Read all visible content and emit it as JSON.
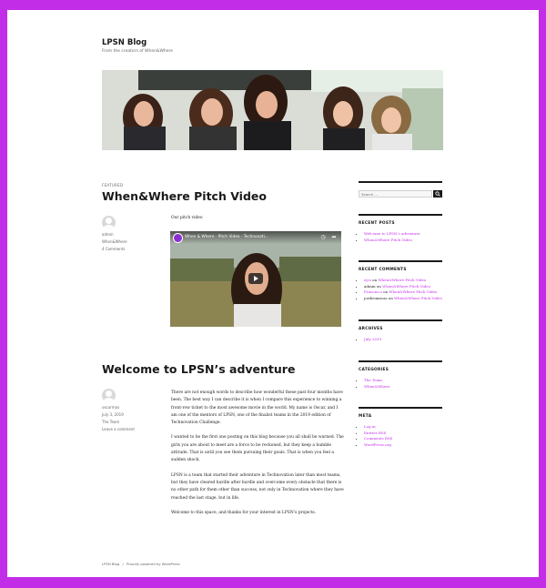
{
  "site": {
    "title": "LPSN Blog",
    "description": "From the creators of When&Where"
  },
  "posts": [
    {
      "label": "Featured",
      "title": "When&Where Pitch Video",
      "author": "admin",
      "category": "When&Where",
      "comments": "4 Comments",
      "intro": "Our pitch video",
      "video": {
        "title": "When & Where - Pitch Video - Technovati..."
      }
    },
    {
      "title": "Welcome to LPSN’s adventure",
      "author": "oscarmas",
      "date": "July 3, 2019",
      "category": "The Team",
      "comments": "Leave a comment",
      "paragraphs": [
        "There are not enough words to describe how wonderful these past four months have been. The best way I can describe it is when I compare this experience to winning a front-row ticket to the most awesome movie in the world. My name is Oscar, and I am one of the mentors of LPSN, one of the finalist teams in the 2019 edition of Technovation Challenge.",
        "I wanted to be the first one posting on this blog because you all shall be warned. The girls you are about to meet are a force to be reckoned, but they keep a humble attitude. That is until you see them pursuing their goals. That is when you feel a sudden shock.",
        "LPSN is a team that started their adventure in Technovation later than most teams, but they have cleared hurdle after hurdle and overcome every obstacle that there is no other path for them other than success, not only in Technovation where they have reached the last stage, but in life.",
        "Welcome to this space, and thanks for your interest in LPSN’s projects."
      ]
    }
  ],
  "sidebar": {
    "search_placeholder": "Search …",
    "recent_posts": {
      "title": "RECENT POSTS",
      "items": [
        "Welcome to LPSN’s adventure",
        "When&Where Pitch Video"
      ]
    },
    "recent_comments": {
      "title": "RECENT COMMENTS",
      "items": [
        {
          "author": "ejcs",
          "sep": " on ",
          "post": "When&Where Pitch Video"
        },
        {
          "author": "admin",
          "sep": " on ",
          "post": "When&Where Pitch Video"
        },
        {
          "author": "Francisco",
          "sep": " on ",
          "post": "When&Where Pitch Video"
        },
        {
          "author": "jordiruiaicas",
          "sep": " on ",
          "post": "When&Where Pitch Video"
        }
      ]
    },
    "archives": {
      "title": "ARCHIVES",
      "items": [
        "July 2019"
      ]
    },
    "categories": {
      "title": "CATEGORIES",
      "items": [
        "The Team",
        "When&Where"
      ]
    },
    "meta": {
      "title": "META",
      "items": [
        "Log in",
        "Entries RSS",
        "Comments RSS",
        "WordPress.org"
      ]
    }
  },
  "footer": {
    "site": "LPSN Blog",
    "sep": "/",
    "powered": "Proudly powered by WordPress"
  },
  "colors": {
    "frame": "#c22ee8",
    "link": "#c22ee8",
    "text": "#1a1a1a"
  }
}
